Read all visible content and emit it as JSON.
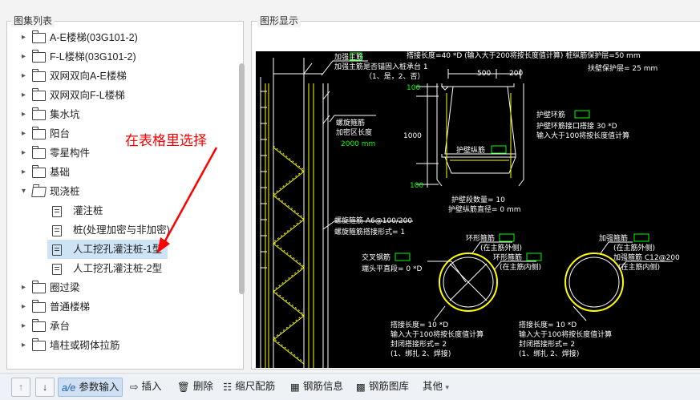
{
  "left_panel": {
    "title": "图集列表",
    "items": [
      {
        "label": "A-E楼梯(03G101-2)",
        "expanded": false
      },
      {
        "label": "F-L楼梯(03G101-2)",
        "expanded": false
      },
      {
        "label": "双网双向A-E楼梯",
        "expanded": false
      },
      {
        "label": "双网双向F-L楼梯",
        "expanded": false
      },
      {
        "label": "集水坑",
        "expanded": false
      },
      {
        "label": "阳台",
        "expanded": false
      },
      {
        "label": "零星构件",
        "expanded": false
      },
      {
        "label": "基础",
        "expanded": false
      },
      {
        "label": "现浇桩",
        "expanded": true,
        "children": [
          {
            "label": "灌注桩"
          },
          {
            "label": "桩(处理加密与非加密)"
          },
          {
            "label": "人工挖孔灌注桩-1型",
            "selected": true
          },
          {
            "label": "人工挖孔灌注桩-2型"
          }
        ]
      },
      {
        "label": "圈过梁",
        "expanded": false
      },
      {
        "label": "普通楼梯",
        "expanded": false
      },
      {
        "label": "承台",
        "expanded": false
      },
      {
        "label": "墙柱或砌体拉筋",
        "expanded": false
      }
    ]
  },
  "right_panel": {
    "title": "图形显示"
  },
  "annotation": {
    "text": "在表格里选择",
    "color": "#ff0000"
  },
  "drawing": {
    "texts": {
      "t1": "加强主筋",
      "t2": "加强主筋是否锚固入桩承台 1",
      "t3": "（1、是，2、否）",
      "t4": "搭接长度=40  *D  (输入大于200将按长度值计算)  桩纵筋保护层=50 mm",
      "t5": "扶壁保护层= 25 mm",
      "d100a": "100",
      "d500": "500",
      "d200": "200",
      "d1000": "1000",
      "d100b": "100",
      "hb1": "护壁环筋",
      "hb2": "护壁环筋接口搭接 30  *D",
      "hb3": "输入大于100将按长度值计算",
      "hbz": "护壁纵筋",
      "hbs": "护壁段数量= 10",
      "hbd": "护壁纵筋直径= 0    mm",
      "lx1": "螺旋箍筋",
      "lx2": "加密区长度",
      "lx3": "2000  mm",
      "lx4": "螺旋箍筋 A6@100/200",
      "lx5": "螺旋箍筋搭接形式= 1",
      "hx1": "环形箍筋",
      "hx2": "(在主筋外侧)",
      "hx3": "环形箍筋",
      "hx4": "(在主筋内侧)",
      "jc1": "交叉钢筋",
      "jc2": "端头平直段= 0  *D",
      "jq1": "加强箍筋",
      "jq2": "(在主筋外侧)",
      "jq3": "加强箍筋 C12@200",
      "jq4": "(在主筋内侧)",
      "bl1": "搭接长度= 10  *D",
      "bl2": "输入大于100将按长度值计算",
      "bl3": "封闭搭接形式= 2",
      "bl4": "(1、绑扎  2、焊接)",
      "br1": "搭接长度= 10  *D",
      "br2": "输入大于100将按长度值计算",
      "br3": "封闭搭接形式= 2",
      "br4": "(1、绑扎  2、焊接)"
    }
  },
  "toolbar": {
    "up_icon": "arrow-up-icon",
    "down_icon": "arrow-down-icon",
    "param_input": "参数输入",
    "insert": "插入",
    "delete": "删除",
    "scale": "缩尺配筋",
    "rebar_info": "钢筋信息",
    "rebar_library": "钢筋图库",
    "other": "其他"
  },
  "colors": {
    "cad_bg": "#000000",
    "cad_line": "#ffffff",
    "cad_text": "#ffffff",
    "cad_green": "#00ff00",
    "cad_yellow": "#ffff00",
    "selection": "#cfe3f7"
  }
}
